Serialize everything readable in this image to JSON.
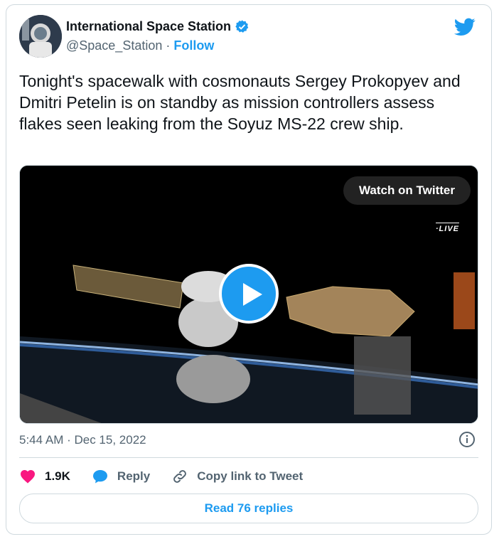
{
  "tweet": {
    "author_name": "International Space Station",
    "handle": "@Space_Station",
    "separator": " · ",
    "follow_label": "Follow",
    "text": "Tonight's spacewalk with cosmonauts Sergey Prokopyev and Dmitri Petelin is on standby as mission controllers assess flakes seen leaking from the Soyuz MS-22 crew ship.",
    "timestamp": "5:44 AM · Dec 15, 2022"
  },
  "media": {
    "watch_label": "Watch on Twitter",
    "live_label": "·LIVE"
  },
  "actions": {
    "likes": "1.9K",
    "reply_label": "Reply",
    "copy_label": "Copy link to Tweet",
    "read_replies_label": "Read 76 replies"
  },
  "colors": {
    "accent": "#1d9bf0",
    "like": "#f91880",
    "muted": "#536471"
  },
  "icons": {
    "verified": "verified-badge-icon",
    "brand": "twitter-bird-icon",
    "info": "info-icon",
    "like": "heart-icon",
    "reply": "speech-bubble-icon",
    "copy": "link-icon",
    "play": "play-icon"
  }
}
